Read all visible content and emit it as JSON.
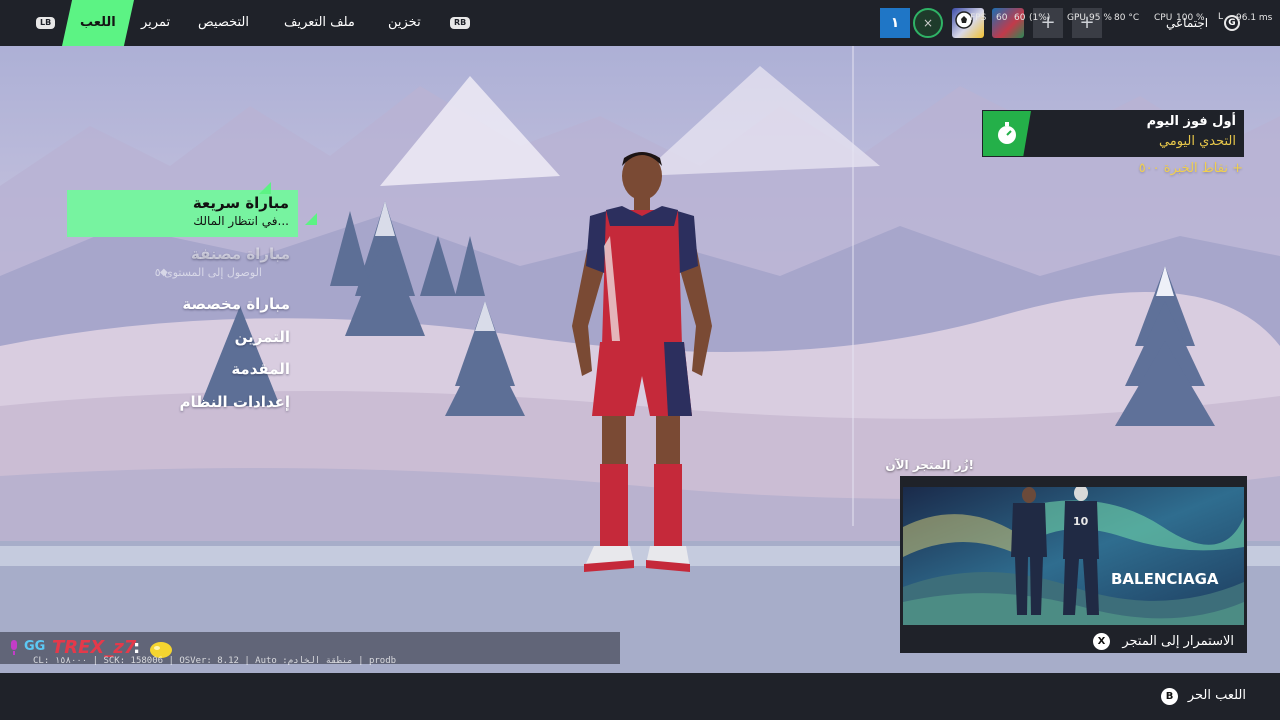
{
  "top_bar": {
    "left_bumper": "LB",
    "right_bumper": "RB",
    "tabs": [
      {
        "label": "اللعب",
        "active": true
      },
      {
        "label": "تمرير",
        "active": false
      },
      {
        "label": "التخصيص",
        "active": false
      },
      {
        "label": "ملف التعريف",
        "active": false
      },
      {
        "label": "تخزين",
        "active": false
      }
    ],
    "party_count": "١",
    "social_label": "اجتماعي",
    "social_button": "G",
    "perf": {
      "fps_label": "FPS",
      "fps_value": "60",
      "fps_target": "60",
      "fps_percent": "(1%)",
      "gpu_label": "GPU",
      "gpu_value": "95 %",
      "gpu_temp": "80 °C",
      "cpu_label": "CPU",
      "cpu_value": "100 %",
      "latency_label": "L",
      "latency_value": "96.1 ms"
    }
  },
  "menu": {
    "quick_match": {
      "title": "مباراة سريعة",
      "subtitle": "في انتظار المالك..."
    },
    "ranked_match": {
      "title": "مباراة مصنفة",
      "subtitle": "الوصول إلى المستوى ٥",
      "locked": true
    },
    "items": [
      {
        "label": "مباراة مخصصة"
      },
      {
        "label": "التمرين"
      },
      {
        "label": "المقدمة"
      },
      {
        "label": "إعدادات النظام"
      }
    ]
  },
  "daily_challenge": {
    "title": "أول فوز اليوم",
    "subtitle": "التحدي اليومي",
    "reward": "نقاط الخبرة ٥٠٠ +",
    "icon": "stopwatch-icon"
  },
  "shop_promo": {
    "heading": "زُر المتجر الآن!",
    "brand": "BALENCIAGA",
    "jersey_number": "10",
    "cta_label": "الاستمرار إلى المتجر",
    "cta_button": "X"
  },
  "chat": {
    "badge": "GG",
    "username": "TREX_z7",
    "separator": ":"
  },
  "debug_line": "CL: ١٥٨٠٠٠ | SCK: 158006 | OSVer: 8.12 | Auto :منطقة الخادم | prodb",
  "footer": {
    "free_play_label": "اللعب الحر",
    "free_play_button": "B"
  },
  "colors": {
    "accent_green": "#77f3a0",
    "active_tab_green": "#5cf384",
    "challenge_gold": "#e6c64a",
    "username_red": "#e5394a",
    "bar_dark": "#1f2229"
  }
}
